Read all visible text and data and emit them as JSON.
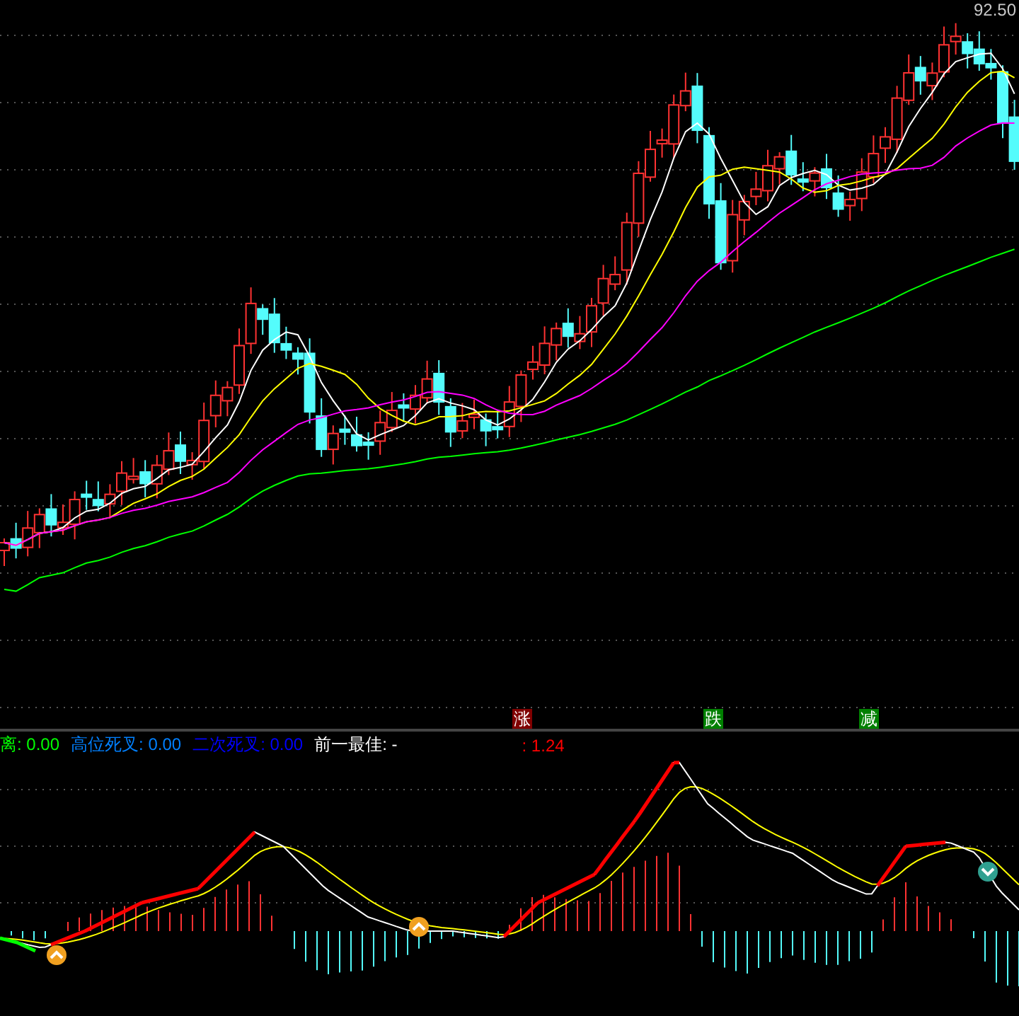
{
  "price_chart": {
    "high_label": "92.50",
    "signals": [
      {
        "text": "涨",
        "kind": "rise"
      },
      {
        "text": "跌",
        "kind": "fall"
      },
      {
        "text": "减",
        "kind": "reduce"
      }
    ]
  },
  "indicator_legend": [
    {
      "text": "离: 0.00",
      "color": "#00ff00"
    },
    {
      "text": "高位死叉: 0.00",
      "color": "#0080ff"
    },
    {
      "text": "二次死叉: 0.00",
      "color": "#0000ff"
    },
    {
      "text": "前一最佳: -",
      "color": "#ffffff"
    },
    {
      "text": ": 1.24",
      "color": "#ff0000"
    }
  ]
}
